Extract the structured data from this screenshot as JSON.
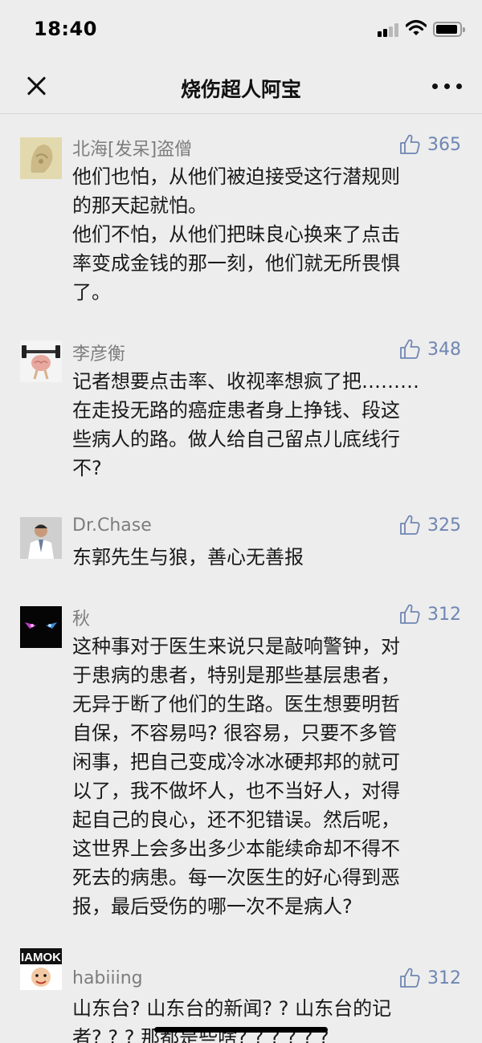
{
  "status_bar": {
    "time": "18:40",
    "signal_icon": "signal-icon",
    "wifi_icon": "wifi-icon",
    "battery_icon": "battery-icon"
  },
  "nav": {
    "title": "烧伤超人阿宝",
    "close_icon": "close-icon",
    "more_icon": "more-icon"
  },
  "comments": [
    {
      "nickname": "北海[发呆]盗僧",
      "likes": "365",
      "lines": [
        "他们也怕，从他们被迫接受这行潜规则",
        "的那天起就怕。",
        "他们不怕，从他们把昧良心换来了点击",
        "率变成金钱的那一刻，他们就无所畏惧",
        "了。"
      ]
    },
    {
      "nickname": "李彦衡",
      "likes": "348",
      "lines": [
        "记者想要点击率、收视率想疯了把………",
        "在走投无路的癌症患者身上挣钱、段这",
        "些病人的路。做人给自己留点儿底线行",
        "不?"
      ]
    },
    {
      "nickname": "Dr.Chase",
      "likes": "325",
      "lines": [
        "东郭先生与狼，善心无善报"
      ]
    },
    {
      "nickname": "秋",
      "likes": "312",
      "lines": [
        "这种事对于医生来说只是敲响警钟，对",
        "于患病的患者，特别是那些基层患者，",
        "无异于断了他们的生路。医生想要明哲",
        "自保，不容易吗? 很容易，只要不多管",
        "闲事，把自己变成冷冰冰硬邦邦的就可",
        "以了，我不做坏人，也不当好人，对得",
        "起自己的良心，还不犯错误。然后呢，",
        "这世界上会多出多少本能续命却不得不",
        "死去的病患。每一次医生的好心得到恶",
        "报，最后受伤的哪一次不是病人?"
      ]
    },
    {
      "nickname": "habiiing",
      "likes": "312",
      "avatar_text": "IAMOK",
      "lines": [
        "山东台? 山东台的新闻? ? 山东台的记",
        "者? ? ? 那都是些啥? ? ? ? ? ?"
      ]
    }
  ],
  "colors": {
    "background": "#ededed",
    "nickname": "#7d7d7d",
    "likes": "#6f86b3",
    "text": "#191919"
  }
}
